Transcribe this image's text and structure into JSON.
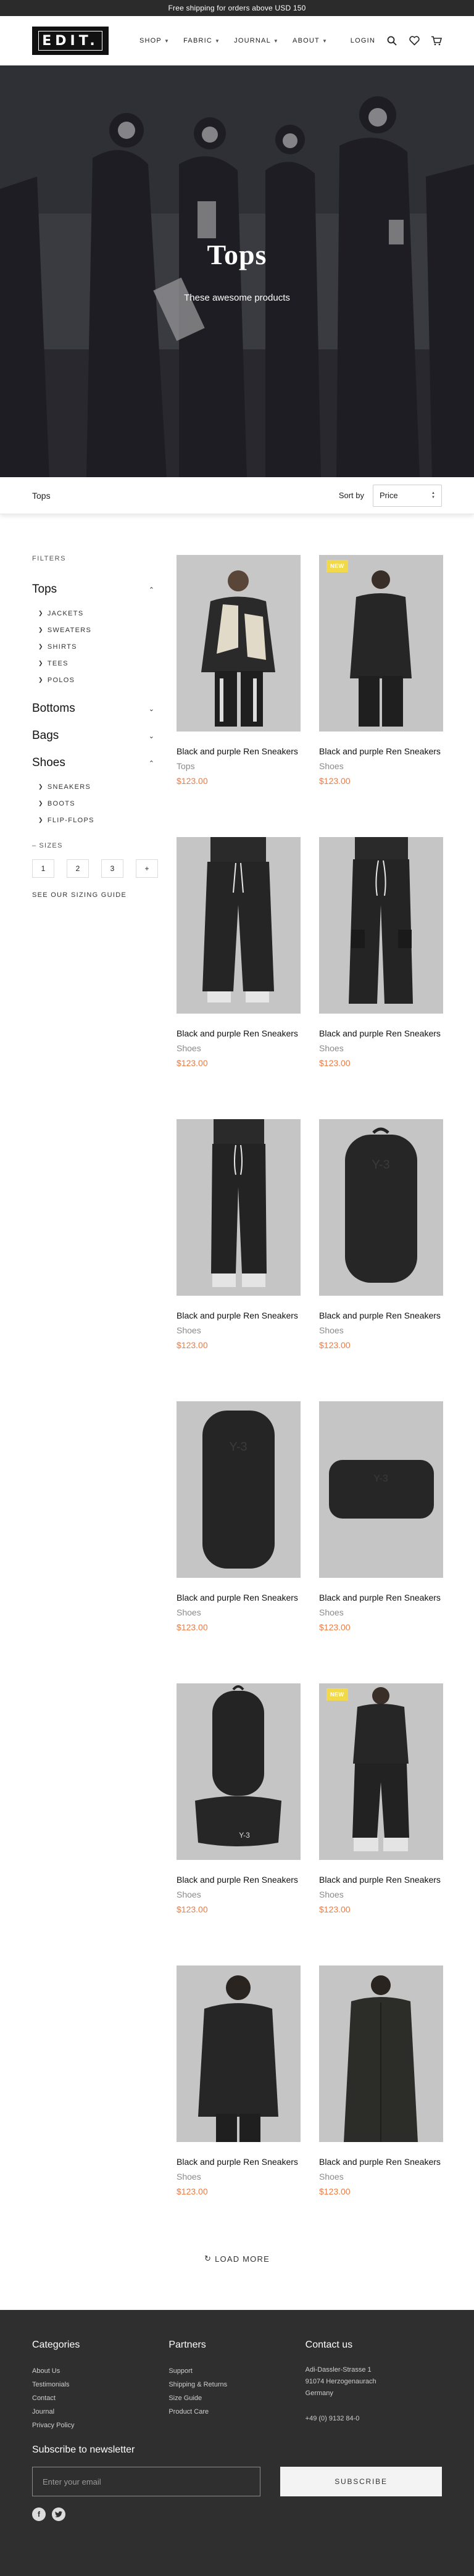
{
  "topbar": {
    "text": "Free shipping for orders above USD 150"
  },
  "header": {
    "logo": "EDIT.",
    "nav": [
      {
        "label": "SHOP"
      },
      {
        "label": "FABRIC"
      },
      {
        "label": "JOURNAL"
      },
      {
        "label": "ABOUT"
      }
    ],
    "login": "LOGIN",
    "icons": [
      "search-icon",
      "heart-icon",
      "cart-icon"
    ]
  },
  "hero": {
    "title": "Tops",
    "subtitle": "These awesome products"
  },
  "toolbar": {
    "breadcrumb": "Tops",
    "sort_label": "Sort by",
    "sort_value": "Price"
  },
  "sidebar": {
    "filters_label": "FILTERS",
    "categories": [
      {
        "name": "Tops",
        "expanded": true,
        "items": [
          "JACKETS",
          "SWEATERS",
          "SHIRTS",
          "TEES",
          "POLOS"
        ]
      },
      {
        "name": "Bottoms",
        "expanded": false,
        "items": []
      },
      {
        "name": "Bags",
        "expanded": false,
        "items": []
      },
      {
        "name": "Shoes",
        "expanded": true,
        "items": [
          "SNEAKERS",
          "BOOTS",
          "FLIP-FLOPS"
        ]
      }
    ],
    "sizes_label": "SIZES",
    "sizes": [
      "1",
      "2",
      "3",
      "+"
    ],
    "sizing_guide": "SEE OUR SIZING GUIDE"
  },
  "products": [
    {
      "name": "Black and purple Ren Sneakers",
      "category": "Tops",
      "price": "$123.00",
      "badge": "",
      "image": "jacket-model"
    },
    {
      "name": "Black and purple Ren Sneakers",
      "category": "Shoes",
      "price": "$123.00",
      "badge": "NEW",
      "image": "black-outfit-model"
    },
    {
      "name": "Black and purple Ren Sneakers",
      "category": "Shoes",
      "price": "$123.00",
      "badge": "",
      "image": "wide-pants"
    },
    {
      "name": "Black and purple Ren Sneakers",
      "category": "Shoes",
      "price": "$123.00",
      "badge": "",
      "image": "cargo-pants"
    },
    {
      "name": "Black and purple Ren Sneakers",
      "category": "Shoes",
      "price": "$123.00",
      "badge": "",
      "image": "jogger-pants"
    },
    {
      "name": "Black and purple Ren Sneakers",
      "category": "Shoes",
      "price": "$123.00",
      "badge": "",
      "image": "backpack"
    },
    {
      "name": "Black and purple Ren Sneakers",
      "category": "Shoes",
      "price": "$123.00",
      "badge": "",
      "image": "backpack-tall"
    },
    {
      "name": "Black and purple Ren Sneakers",
      "category": "Shoes",
      "price": "$123.00",
      "badge": "",
      "image": "waist-bag"
    },
    {
      "name": "Black and purple Ren Sneakers",
      "category": "Shoes",
      "price": "$123.00",
      "badge": "",
      "image": "sling-bag"
    },
    {
      "name": "Black and purple Ren Sneakers",
      "category": "Shoes",
      "price": "$123.00",
      "badge": "NEW",
      "image": "track-pants-model"
    },
    {
      "name": "Black and purple Ren Sneakers",
      "category": "Shoes",
      "price": "$123.00",
      "badge": "",
      "image": "coat-model"
    },
    {
      "name": "Black and purple Ren Sneakers",
      "category": "Shoes",
      "price": "$123.00",
      "badge": "",
      "image": "long-coat-model"
    }
  ],
  "load_more": "LOAD MORE",
  "footer": {
    "categories_title": "Categories",
    "categories": [
      "About Us",
      "Testimonials",
      "Contact",
      "Journal",
      "Privacy Policy"
    ],
    "partners_title": "Partners",
    "partners": [
      "Support",
      "Shipping & Returns",
      "Size Guide",
      "Product Care"
    ],
    "contact_title": "Contact us",
    "address": [
      "Adi-Dassler-Strasse 1",
      "91074 Herzogenaurach",
      "Germany"
    ],
    "phone": "+49 (0) 9132 84-0",
    "newsletter_title": "Subscribe to newsletter",
    "email_placeholder": "Enter your email",
    "subscribe": "SUBSCRIBE",
    "social": [
      "facebook-icon",
      "twitter-icon"
    ]
  },
  "colors": {
    "price": "#ee7a40",
    "badge": "#f2d94a",
    "footer_bg": "#2f2f2f",
    "topbar_bg": "#2b2b2b"
  }
}
